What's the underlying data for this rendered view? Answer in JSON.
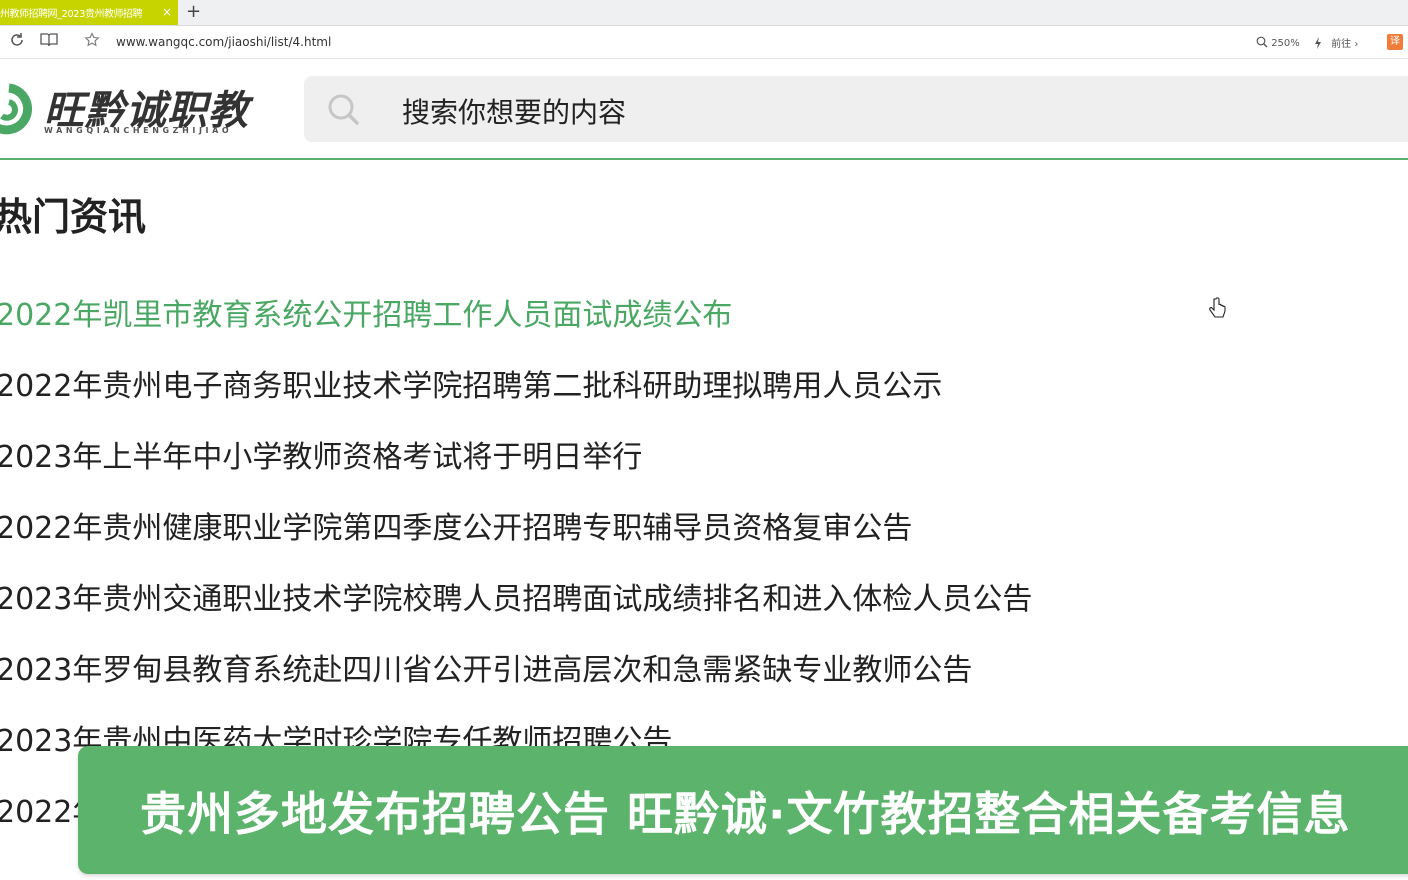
{
  "browser": {
    "tab_title": "州教师招聘网_2023贵州教师招聘",
    "tab_close": "×",
    "new_tab": "+",
    "url": "www.wangqc.com/jiaoshi/list/4.html",
    "zoom": "250%",
    "goto_label": "前往",
    "goto_chevron": "›",
    "translate_label": "译",
    "icons": {
      "reload": "reload-icon",
      "reader": "reader-icon",
      "bookmark": "star-icon",
      "zoom": "zoom-icon",
      "lightning": "lightning-icon"
    }
  },
  "site": {
    "logo_text": "旺黔诚职教",
    "logo_sub": "WANGQIANCHENGZHIJIAO",
    "search_placeholder": "搜索你想要的内容",
    "accent_color": "#5aae6b"
  },
  "main": {
    "section_title": "热门资讯",
    "news": [
      {
        "title": "2022年凯里市教育系统公开招聘工作人员面试成绩公布",
        "active": true
      },
      {
        "title": "2022年贵州电子商务职业技术学院招聘第二批科研助理拟聘用人员公示",
        "active": false
      },
      {
        "title": "2023年上半年中小学教师资格考试将于明日举行",
        "active": false
      },
      {
        "title": "2022年贵州健康职业学院第四季度公开招聘专职辅导员资格复审公告",
        "active": false
      },
      {
        "title": "2023年贵州交通职业技术学院校聘人员招聘面试成绩排名和进入体检人员公告",
        "active": false
      },
      {
        "title": "2023年罗甸县教育系统赴四川省公开引进高层次和急需紧缺专业教师公告",
        "active": false
      },
      {
        "title": "2023年贵州中医药大学时珍学院专任教师招聘公告",
        "active": false
      },
      {
        "title": "2022年",
        "active": false
      }
    ]
  },
  "banner": {
    "text": "贵州多地发布招聘公告  旺黔诚·文竹教招整合相关备考信息"
  }
}
